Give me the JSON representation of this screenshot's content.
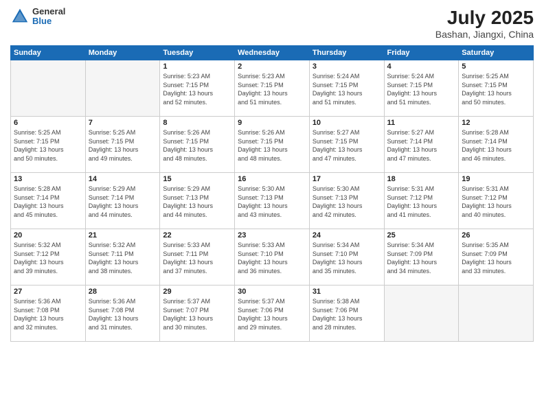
{
  "header": {
    "logo_general": "General",
    "logo_blue": "Blue",
    "month": "July 2025",
    "location": "Bashan, Jiangxi, China"
  },
  "weekdays": [
    "Sunday",
    "Monday",
    "Tuesday",
    "Wednesday",
    "Thursday",
    "Friday",
    "Saturday"
  ],
  "weeks": [
    [
      {
        "day": "",
        "info": ""
      },
      {
        "day": "",
        "info": ""
      },
      {
        "day": "1",
        "info": "Sunrise: 5:23 AM\nSunset: 7:15 PM\nDaylight: 13 hours\nand 52 minutes."
      },
      {
        "day": "2",
        "info": "Sunrise: 5:23 AM\nSunset: 7:15 PM\nDaylight: 13 hours\nand 51 minutes."
      },
      {
        "day": "3",
        "info": "Sunrise: 5:24 AM\nSunset: 7:15 PM\nDaylight: 13 hours\nand 51 minutes."
      },
      {
        "day": "4",
        "info": "Sunrise: 5:24 AM\nSunset: 7:15 PM\nDaylight: 13 hours\nand 51 minutes."
      },
      {
        "day": "5",
        "info": "Sunrise: 5:25 AM\nSunset: 7:15 PM\nDaylight: 13 hours\nand 50 minutes."
      }
    ],
    [
      {
        "day": "6",
        "info": "Sunrise: 5:25 AM\nSunset: 7:15 PM\nDaylight: 13 hours\nand 50 minutes."
      },
      {
        "day": "7",
        "info": "Sunrise: 5:25 AM\nSunset: 7:15 PM\nDaylight: 13 hours\nand 49 minutes."
      },
      {
        "day": "8",
        "info": "Sunrise: 5:26 AM\nSunset: 7:15 PM\nDaylight: 13 hours\nand 48 minutes."
      },
      {
        "day": "9",
        "info": "Sunrise: 5:26 AM\nSunset: 7:15 PM\nDaylight: 13 hours\nand 48 minutes."
      },
      {
        "day": "10",
        "info": "Sunrise: 5:27 AM\nSunset: 7:15 PM\nDaylight: 13 hours\nand 47 minutes."
      },
      {
        "day": "11",
        "info": "Sunrise: 5:27 AM\nSunset: 7:14 PM\nDaylight: 13 hours\nand 47 minutes."
      },
      {
        "day": "12",
        "info": "Sunrise: 5:28 AM\nSunset: 7:14 PM\nDaylight: 13 hours\nand 46 minutes."
      }
    ],
    [
      {
        "day": "13",
        "info": "Sunrise: 5:28 AM\nSunset: 7:14 PM\nDaylight: 13 hours\nand 45 minutes."
      },
      {
        "day": "14",
        "info": "Sunrise: 5:29 AM\nSunset: 7:14 PM\nDaylight: 13 hours\nand 44 minutes."
      },
      {
        "day": "15",
        "info": "Sunrise: 5:29 AM\nSunset: 7:13 PM\nDaylight: 13 hours\nand 44 minutes."
      },
      {
        "day": "16",
        "info": "Sunrise: 5:30 AM\nSunset: 7:13 PM\nDaylight: 13 hours\nand 43 minutes."
      },
      {
        "day": "17",
        "info": "Sunrise: 5:30 AM\nSunset: 7:13 PM\nDaylight: 13 hours\nand 42 minutes."
      },
      {
        "day": "18",
        "info": "Sunrise: 5:31 AM\nSunset: 7:12 PM\nDaylight: 13 hours\nand 41 minutes."
      },
      {
        "day": "19",
        "info": "Sunrise: 5:31 AM\nSunset: 7:12 PM\nDaylight: 13 hours\nand 40 minutes."
      }
    ],
    [
      {
        "day": "20",
        "info": "Sunrise: 5:32 AM\nSunset: 7:12 PM\nDaylight: 13 hours\nand 39 minutes."
      },
      {
        "day": "21",
        "info": "Sunrise: 5:32 AM\nSunset: 7:11 PM\nDaylight: 13 hours\nand 38 minutes."
      },
      {
        "day": "22",
        "info": "Sunrise: 5:33 AM\nSunset: 7:11 PM\nDaylight: 13 hours\nand 37 minutes."
      },
      {
        "day": "23",
        "info": "Sunrise: 5:33 AM\nSunset: 7:10 PM\nDaylight: 13 hours\nand 36 minutes."
      },
      {
        "day": "24",
        "info": "Sunrise: 5:34 AM\nSunset: 7:10 PM\nDaylight: 13 hours\nand 35 minutes."
      },
      {
        "day": "25",
        "info": "Sunrise: 5:34 AM\nSunset: 7:09 PM\nDaylight: 13 hours\nand 34 minutes."
      },
      {
        "day": "26",
        "info": "Sunrise: 5:35 AM\nSunset: 7:09 PM\nDaylight: 13 hours\nand 33 minutes."
      }
    ],
    [
      {
        "day": "27",
        "info": "Sunrise: 5:36 AM\nSunset: 7:08 PM\nDaylight: 13 hours\nand 32 minutes."
      },
      {
        "day": "28",
        "info": "Sunrise: 5:36 AM\nSunset: 7:08 PM\nDaylight: 13 hours\nand 31 minutes."
      },
      {
        "day": "29",
        "info": "Sunrise: 5:37 AM\nSunset: 7:07 PM\nDaylight: 13 hours\nand 30 minutes."
      },
      {
        "day": "30",
        "info": "Sunrise: 5:37 AM\nSunset: 7:06 PM\nDaylight: 13 hours\nand 29 minutes."
      },
      {
        "day": "31",
        "info": "Sunrise: 5:38 AM\nSunset: 7:06 PM\nDaylight: 13 hours\nand 28 minutes."
      },
      {
        "day": "",
        "info": ""
      },
      {
        "day": "",
        "info": ""
      }
    ]
  ]
}
